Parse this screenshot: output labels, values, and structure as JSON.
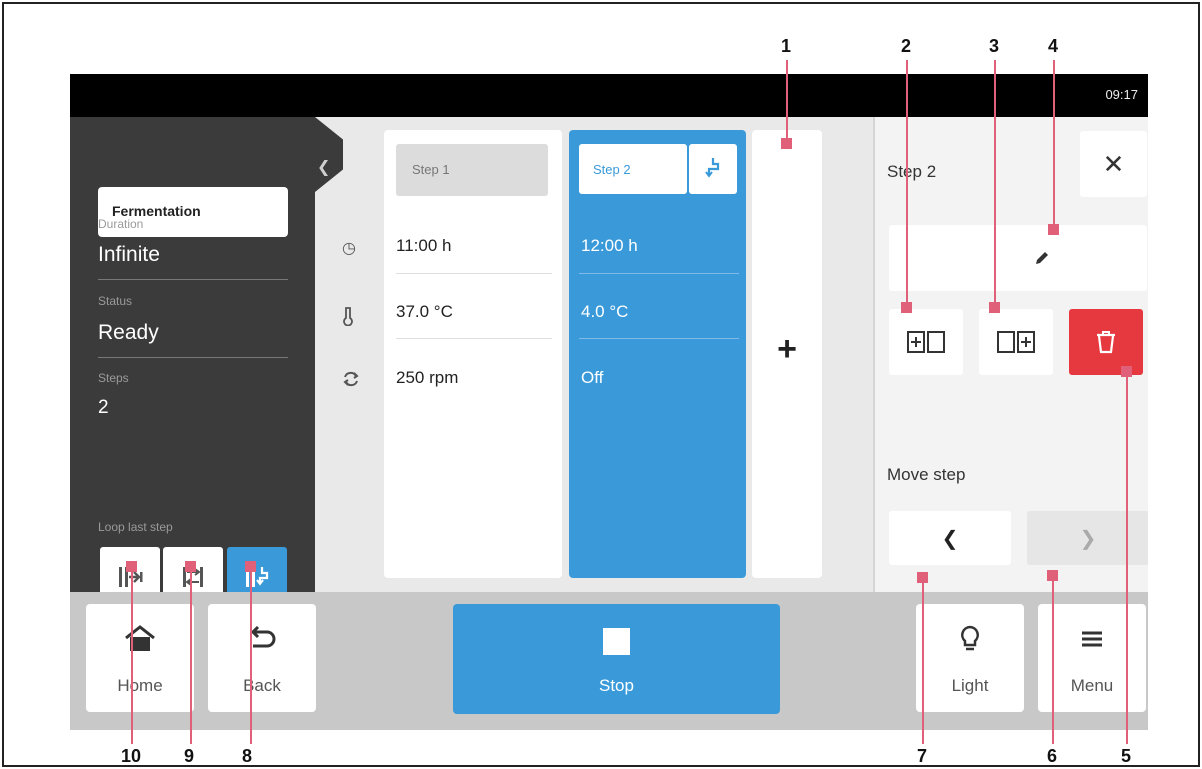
{
  "statusbar": {
    "time": "09:17"
  },
  "program": {
    "name": "Fermentation",
    "duration_label": "Duration",
    "duration_value": "Infinite",
    "status_label": "Status",
    "status_value": "Ready",
    "steps_label": "Steps",
    "steps_value": "2",
    "loop_label": "Loop last step"
  },
  "steps": [
    {
      "name": "Step 1",
      "time": "11:00 h",
      "temp": "37.0 °C",
      "shaking": "250 rpm"
    },
    {
      "name": "Step 2",
      "time": "12:00 h",
      "temp": "4.0 °C",
      "shaking": "Off"
    }
  ],
  "edit_panel": {
    "title": "Step 2",
    "move_label": "Move step"
  },
  "bottom_bar": {
    "home": "Home",
    "back": "Back",
    "stop": "Stop",
    "light": "Light",
    "menu": "Menu"
  },
  "callouts": [
    "1",
    "2",
    "3",
    "4",
    "5",
    "6",
    "7",
    "8",
    "9",
    "10"
  ],
  "colors": {
    "accent": "#3a9ad9",
    "delete": "#e5383f",
    "callout": "#e0607a",
    "panel_dark": "#3b3b3b"
  }
}
